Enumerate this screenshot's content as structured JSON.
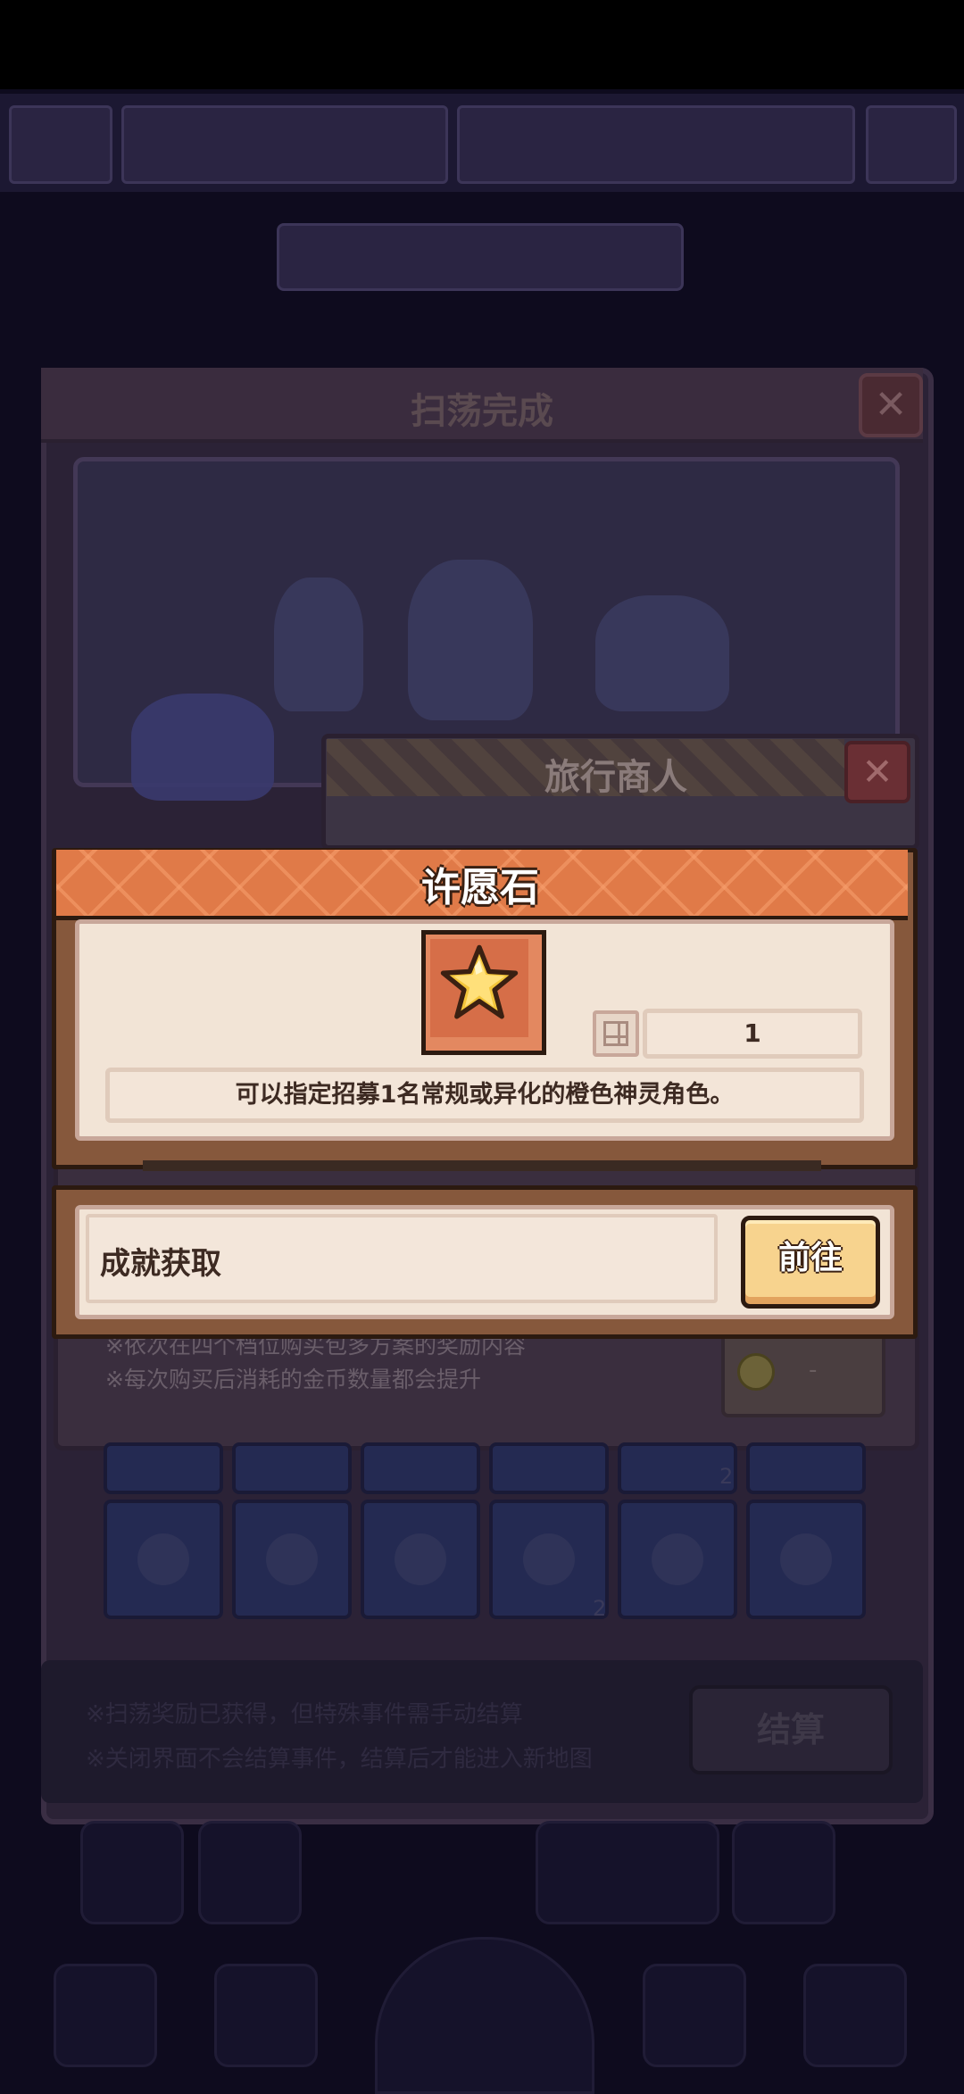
{
  "background": {
    "panel_title": "扫荡完成",
    "close_glyph": "✕",
    "merchant_title": "旅行商人",
    "merchant_notes": [
      "※依次在四个档位购买包多方案的奖励内容",
      "※每次购买后消耗的金币数量都会提升"
    ],
    "coin_price": "-",
    "grid_badges": [
      "2",
      "2"
    ],
    "bottom_notes": [
      "※扫荡奖励已获得，但特殊事件需手动结算",
      "※关闭界面不会结算事件，结算后才能进入新地图"
    ],
    "settle_label": "结算"
  },
  "item_popup": {
    "title": "许愿石",
    "item_icon": "star-icon",
    "quantity": "1",
    "description": "可以指定招募1名常规或异化的橙色神灵角色。"
  },
  "source_row": {
    "label": "成就获取",
    "go_label": "前往"
  },
  "colors": {
    "header_orange": "#e07a48",
    "frame_brown": "#86583c",
    "body_cream": "#f2e4d6",
    "button_gold": "#f7d38e",
    "overlay_dark": "#0e0b1e"
  }
}
